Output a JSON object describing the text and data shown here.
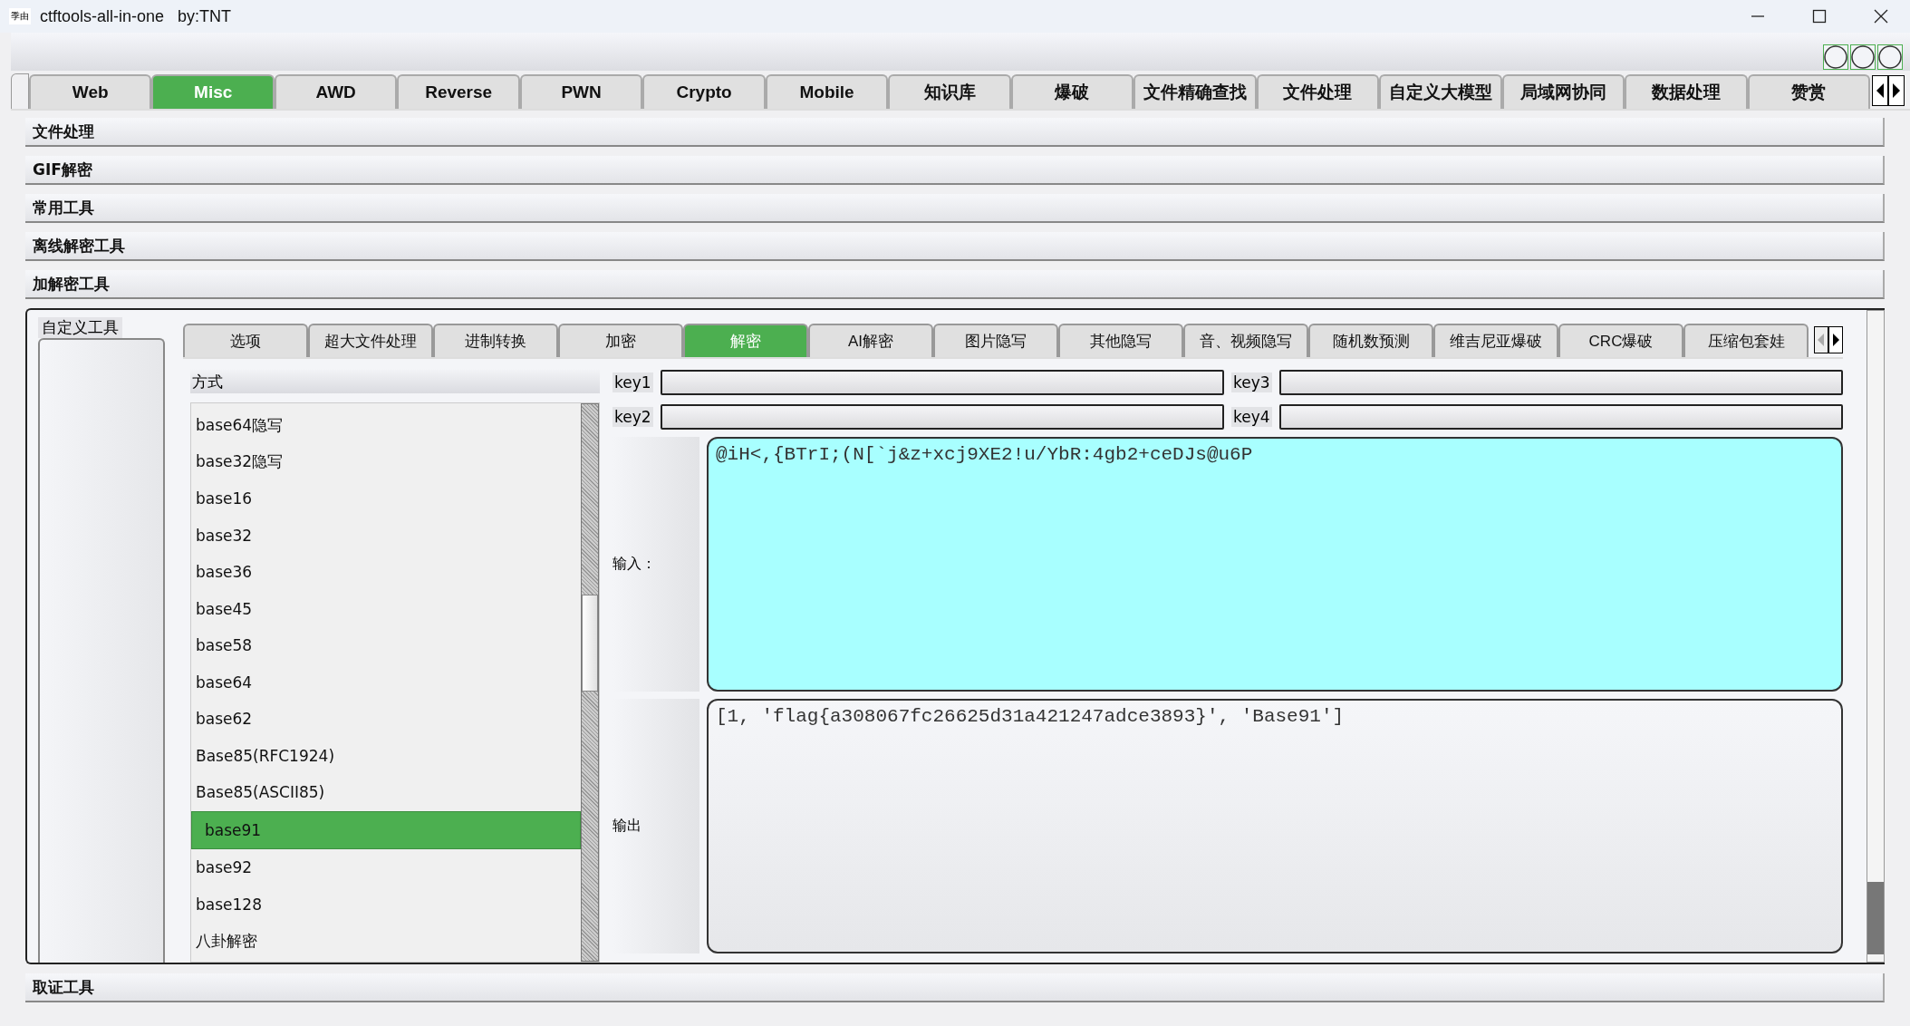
{
  "window": {
    "icon_text": "季由",
    "title": "ctftools-all-in-one   by:TNT"
  },
  "main_tabs": [
    {
      "label": "Web",
      "selected": false
    },
    {
      "label": "Misc",
      "selected": true
    },
    {
      "label": "AWD",
      "selected": false
    },
    {
      "label": "Reverse",
      "selected": false
    },
    {
      "label": "PWN",
      "selected": false
    },
    {
      "label": "Crypto",
      "selected": false
    },
    {
      "label": "Mobile",
      "selected": false
    },
    {
      "label": "知识库",
      "selected": false
    },
    {
      "label": "爆破",
      "selected": false
    },
    {
      "label": "文件精确查找",
      "selected": false
    },
    {
      "label": "文件处理",
      "selected": false
    },
    {
      "label": "自定义大模型",
      "selected": false
    },
    {
      "label": "局域网协同",
      "selected": false
    },
    {
      "label": "数据处理",
      "selected": false
    },
    {
      "label": "赞赏",
      "selected": false
    }
  ],
  "sections": [
    {
      "label": "文件处理"
    },
    {
      "label": "GIF解密"
    },
    {
      "label": "常用工具"
    },
    {
      "label": "离线解密工具"
    },
    {
      "label": "加解密工具"
    }
  ],
  "sections_below": [
    {
      "label": "取证工具"
    }
  ],
  "panel": {
    "custom_group": {
      "title": "自定义工具"
    },
    "sub_tabs": [
      {
        "label": "选项",
        "selected": false
      },
      {
        "label": "超大文件处理",
        "selected": false
      },
      {
        "label": "进制转换",
        "selected": false
      },
      {
        "label": "加密",
        "selected": false
      },
      {
        "label": "解密",
        "selected": true
      },
      {
        "label": "AI解密",
        "selected": false
      },
      {
        "label": "图片隐写",
        "selected": false
      },
      {
        "label": "其他隐写",
        "selected": false
      },
      {
        "label": "音、视频隐写",
        "selected": false
      },
      {
        "label": "随机数预测",
        "selected": false
      },
      {
        "label": "维吉尼亚爆破",
        "selected": false
      },
      {
        "label": "CRC爆破",
        "selected": false
      },
      {
        "label": "压缩包套娃",
        "selected": false
      }
    ],
    "method_header": "方式",
    "methods": [
      {
        "label": "base64隐写",
        "selected": false
      },
      {
        "label": "base32隐写",
        "selected": false
      },
      {
        "label": "base16",
        "selected": false
      },
      {
        "label": "base32",
        "selected": false
      },
      {
        "label": "base36",
        "selected": false
      },
      {
        "label": "base45",
        "selected": false
      },
      {
        "label": "base58",
        "selected": false
      },
      {
        "label": "base64",
        "selected": false
      },
      {
        "label": "base62",
        "selected": false
      },
      {
        "label": "Base85(RFC1924)",
        "selected": false
      },
      {
        "label": "Base85(ASCII85)",
        "selected": false
      },
      {
        "label": "base91",
        "selected": true
      },
      {
        "label": "base92",
        "selected": false
      },
      {
        "label": "base128",
        "selected": false
      },
      {
        "label": "八卦解密",
        "selected": false
      }
    ],
    "keys": [
      {
        "label": "key1"
      },
      {
        "label": "key3"
      },
      {
        "label": "key2"
      },
      {
        "label": "key4"
      }
    ],
    "input_label": "输入：",
    "input": "@iH<,{BTrI;(N[`j&z+xcj9XE2!u/YbR:4gb2+ceDJs@u6P",
    "output_label": "输出",
    "output": "[1, 'flag{a308067fc26625d31a421247adce3893}', 'Base91']"
  }
}
